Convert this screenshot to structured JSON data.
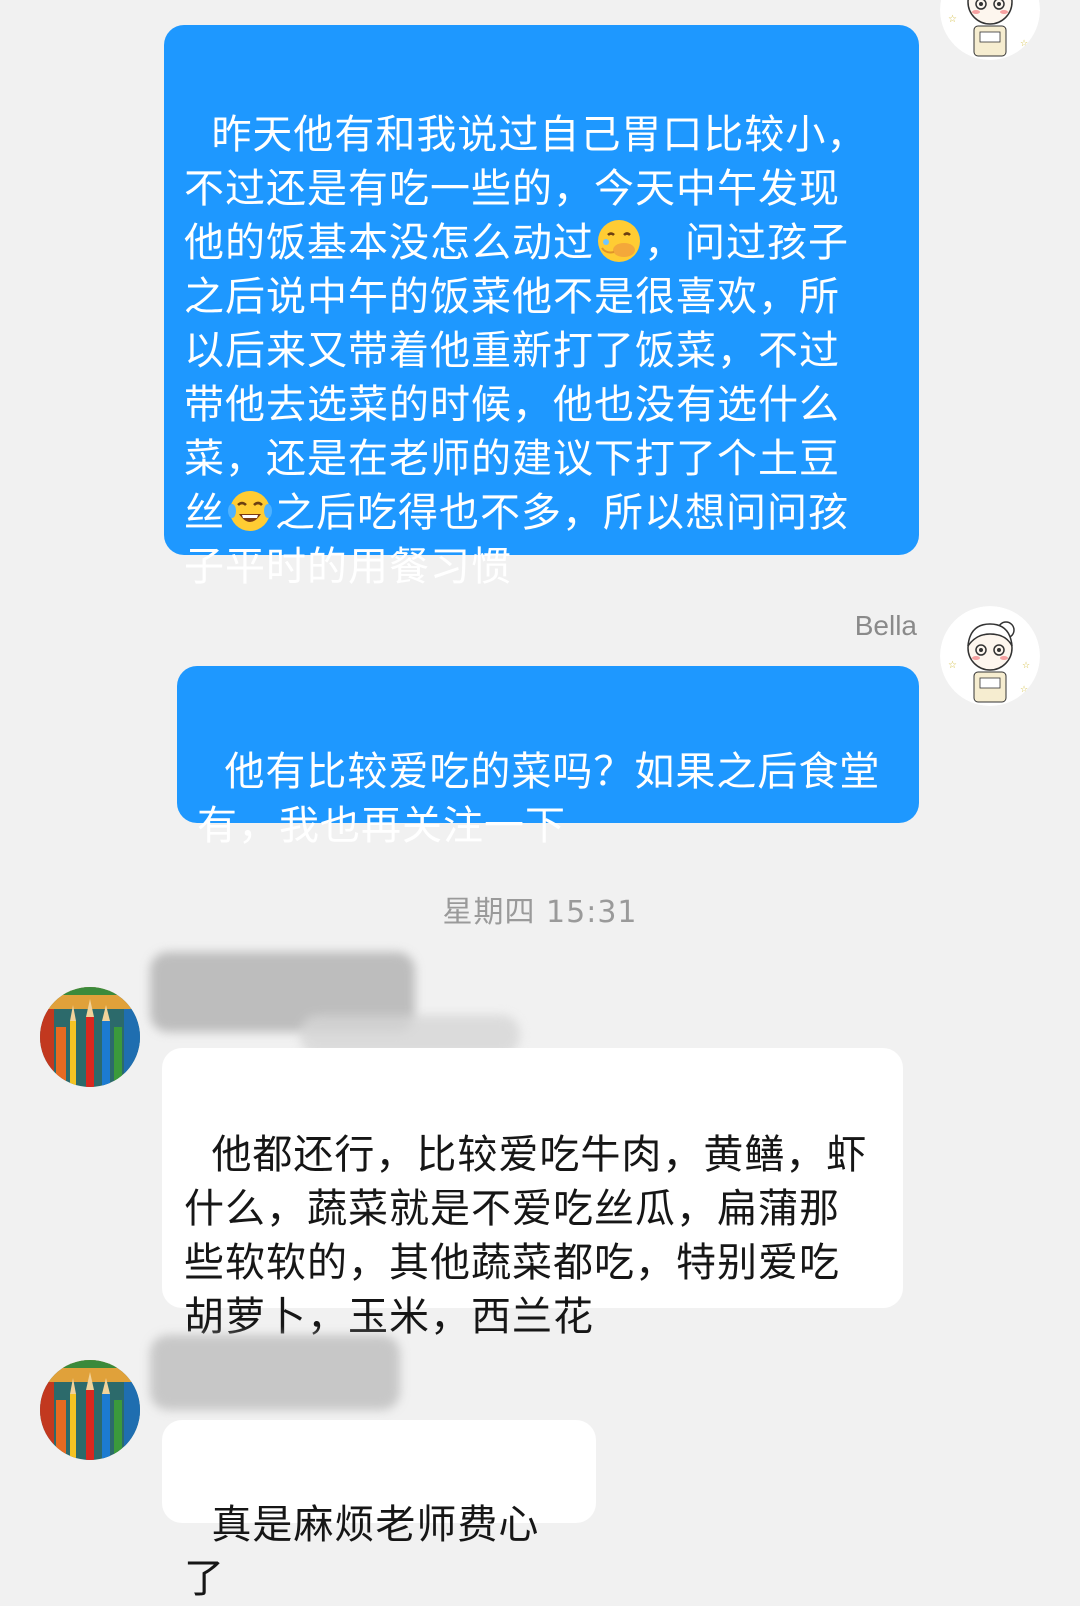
{
  "messages": [
    {
      "id": "m1",
      "direction": "outgoing",
      "parts": [
        "昨天他有和我说过自己胃口比较小，\n不过还是有吃一些的，今天中午发现\n他的饭基本没怎么动过",
        "，问过孩子\n之后说中午的饭菜他不是很喜欢，所\n以后来又带着他重新打了饭菜，不过\n带他去选菜的时候，他也没有选什么\n菜，还是在老师的建议下打了个土豆\n丝",
        "之后吃得也不多，所以想问问孩\n子平时的用餐习惯"
      ],
      "emojis": [
        "face-with-hand-over-mouth-emoji",
        "tears-of-joy-emoji"
      ]
    },
    {
      "id": "m2",
      "direction": "outgoing",
      "sender": "Bella",
      "text": "他有比较爱吃的菜吗？如果之后食堂\n有，我也再关注一下"
    },
    {
      "id": "m3",
      "direction": "incoming",
      "text": "他都还行，比较爱吃牛肉，黄鳝，虾\n什么，蔬菜就是不爱吃丝瓜，扁蒲那\n些软软的，其他蔬菜都吃，特别爱吃\n胡萝卜，玉米，西兰花"
    },
    {
      "id": "m4",
      "direction": "incoming",
      "text": "真是麻烦老师费心了"
    }
  ],
  "timestamp": "星期四 15:31",
  "avatars": {
    "self": "cartoon-girl-avatar",
    "other": "colored-pencils-avatar"
  },
  "colors": {
    "background": "#f1f1f1",
    "outgoing_bubble": "#1e98ff",
    "incoming_bubble": "#ffffff",
    "outgoing_text": "#ffffff",
    "incoming_text": "#161616",
    "meta_text": "#9a9a9a"
  }
}
